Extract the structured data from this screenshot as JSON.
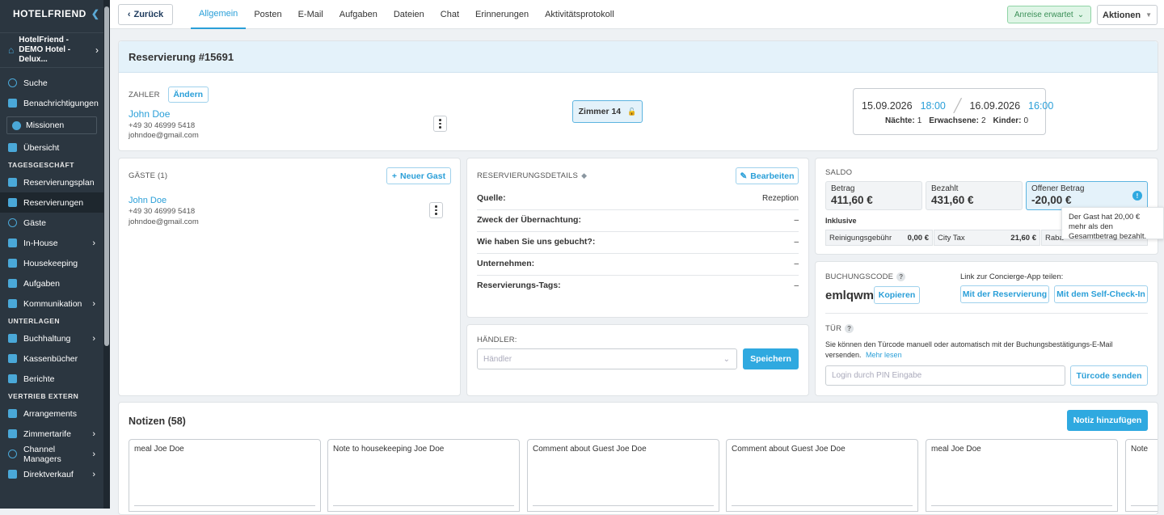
{
  "sidebar": {
    "brand": "HOTELFRIEND",
    "hotel": "HotelFriend - DEMO Hotel - Delux...",
    "missionen": "Missionen",
    "items_top": [
      {
        "label": "Suche"
      },
      {
        "label": "Benachrichtigungen"
      }
    ],
    "uebersicht": "Übersicht",
    "sections": [
      "TAGESGESCHÄFT",
      "UNTERLAGEN",
      "VERTRIEB EXTERN"
    ],
    "tagesgeschaeft": [
      "Reservierungsplan",
      "Reservierungen",
      "Gäste",
      "In-House",
      "Housekeeping",
      "Aufgaben",
      "Kommunikation"
    ],
    "unterlagen": [
      "Buchhaltung",
      "Kassenbücher",
      "Berichte"
    ],
    "vertrieb": [
      "Arrangements",
      "Zimmertarife",
      "Channel Managers",
      "Direktverkauf"
    ]
  },
  "topbar": {
    "back": "Zurück",
    "tabs": [
      "Allgemein",
      "Posten",
      "E-Mail",
      "Aufgaben",
      "Dateien",
      "Chat",
      "Erinnerungen",
      "Aktivitätsprotokoll"
    ],
    "status": "Anreise erwartet",
    "actions": "Aktionen"
  },
  "reservation": {
    "title": "Reservierung #15691",
    "payer_label": "ZAHLER",
    "change": "Ändern",
    "payer_name": "John Doe",
    "payer_phone": "+49 30 46999 5418",
    "payer_email": "johndoe@gmail.com",
    "room": "Zimmer 14",
    "arrival_date": "15.09.2026",
    "arrival_time": "18:00",
    "departure_date": "16.09.2026",
    "departure_time": "16:00",
    "nights_label": "Nächte:",
    "nights": "1",
    "adults_label": "Erwachsene:",
    "adults": "2",
    "children_label": "Kinder:",
    "children": "0"
  },
  "guests": {
    "title": "GÄSTE (1)",
    "new_guest": "Neuer Gast",
    "name": "John Doe",
    "phone": "+49 30 46999 5418",
    "email": "johndoe@gmail.com"
  },
  "details": {
    "title": "RESERVIERUNGSDETAILS",
    "edit": "Bearbeiten",
    "rows": [
      {
        "k": "Quelle:",
        "v": "Rezeption"
      },
      {
        "k": "Zweck der Übernachtung:",
        "v": "–"
      },
      {
        "k": "Wie haben Sie uns gebucht?:",
        "v": "–"
      },
      {
        "k": "Unternehmen:",
        "v": "–"
      },
      {
        "k": "Reservierungs-Tags:",
        "v": "–"
      }
    ]
  },
  "haendler": {
    "title": "HÄNDLER:",
    "placeholder": "Händler",
    "save": "Speichern"
  },
  "saldo": {
    "title": "SALDO",
    "betrag_label": "Betrag",
    "betrag": "411,60 €",
    "bezahlt_label": "Bezahlt",
    "bezahlt": "431,60 €",
    "offen_label": "Offener Betrag",
    "offen": "-20,00 €",
    "inklusive": "Inklusive",
    "items": [
      {
        "k": "Reinigungsgebühr",
        "v": "0,00 €"
      },
      {
        "k": "City Tax",
        "v": "21,60 €"
      },
      {
        "k": "Raba",
        "v": ""
      }
    ],
    "tooltip": "Der Gast hat 20,00 € mehr als den Gesamtbetrag bezahlt."
  },
  "booking": {
    "code_label": "BUCHUNGSCODE",
    "code": "emlqwm",
    "copy": "Kopieren",
    "share_label": "Link zur Concierge-App teilen:",
    "with_res": "Mit der Reservierung",
    "with_checkin": "Mit dem Self-Check-In",
    "door_label": "TÜR",
    "door_text": "Sie können den Türcode manuell oder automatisch mit der Buchungsbestätigungs-E-Mail versenden.",
    "more": "Mehr lesen",
    "pin_placeholder": "Login durch PIN Eingabe",
    "send_code": "Türcode senden"
  },
  "notes": {
    "title": "Notizen (58)",
    "add": "Notiz hinzufügen",
    "items": [
      "meal Joe Doe",
      "Note to housekeeping Joe Doe",
      "Comment about Guest Joe Doe",
      "Comment about Guest Joe Doe",
      "meal Joe Doe",
      "Note"
    ]
  },
  "colors": {
    "accent": "#2fa9e0",
    "sidebar": "#2b3640",
    "status_green": "#dff5e6"
  }
}
